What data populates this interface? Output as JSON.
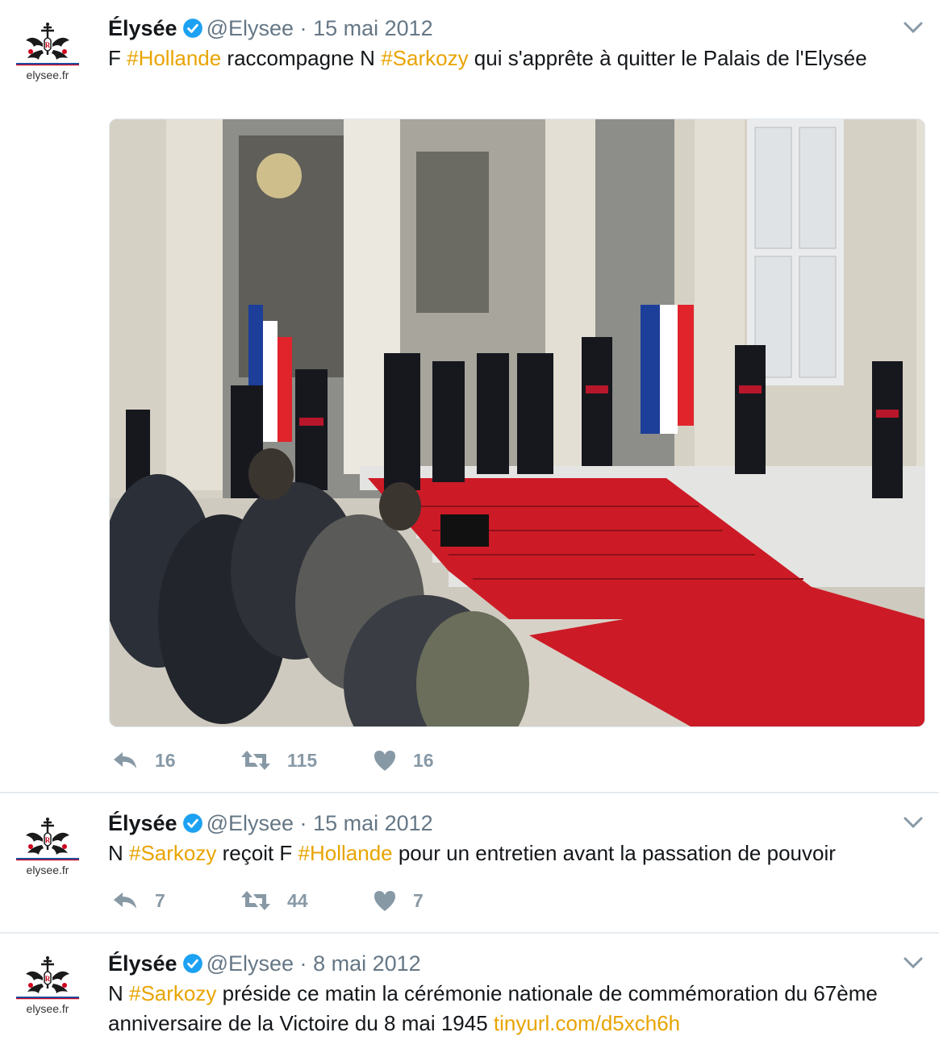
{
  "colors": {
    "hashtag": "#e8a400",
    "meta": "#657786",
    "action": "#8899a6",
    "verified": "#1da1f2"
  },
  "tweets": [
    {
      "avatar_label": "elysee.fr",
      "name": "Élysée",
      "handle": "@Elysee",
      "separator": "·",
      "date": "15 mai 2012",
      "text_parts": [
        "F ",
        "#Hollande",
        " raccompagne N ",
        "#Sarkozy",
        " qui s'apprête à quitter le Palais de l'Elysée"
      ],
      "replies": "16",
      "retweets": "115",
      "likes": "16"
    },
    {
      "avatar_label": "elysee.fr",
      "name": "Élysée",
      "handle": "@Elysee",
      "separator": "·",
      "date": "15 mai 2012",
      "text_parts": [
        "N ",
        "#Sarkozy",
        " reçoit F ",
        "#Hollande",
        " pour un entretien avant la passation de pouvoir"
      ],
      "replies": "7",
      "retweets": "44",
      "likes": "7"
    },
    {
      "avatar_label": "elysee.fr",
      "name": "Élysée",
      "handle": "@Elysee",
      "separator": "·",
      "date": "8 mai 2012",
      "text_parts": [
        "N ",
        "#Sarkozy",
        " préside ce matin la cérémonie nationale de commémoration du 67ème anniversaire de la Victoire du 8 mai 1945 ",
        "tinyurl.com/d5xch6h"
      ]
    }
  ],
  "icons": {
    "avatar": "elysee-logo-icon",
    "verified": "verified-badge-icon",
    "menu": "chevron-down-icon",
    "reply": "reply-icon",
    "retweet": "retweet-icon",
    "like": "heart-icon",
    "photo": "palace-steps-photo"
  }
}
